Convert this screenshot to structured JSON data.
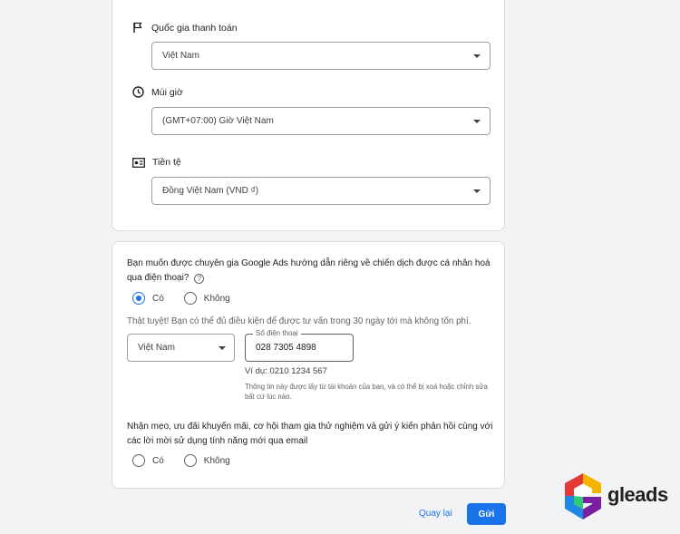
{
  "billing": {
    "country_label": "Quốc gia thanh toán",
    "country_value": "Việt Nam",
    "timezone_label": "Múi giờ",
    "timezone_value": "(GMT+07:00) Giờ Việt Nam",
    "currency_label": "Tiền tệ",
    "currency_value": "Đồng Việt Nam (VND ₫)"
  },
  "expert": {
    "question": "Bạn muốn được chuyên gia Google Ads hướng dẫn riêng về chiến dịch được cá nhân hoá qua điện thoại?",
    "help_glyph": "?",
    "options": [
      "Có",
      "Không"
    ],
    "selected": "Có",
    "eligible_text": "Thật tuyệt! Bạn có thể đủ điều kiện để được tư vấn trong 30 ngày tới mà không tốn phí.",
    "phone_country": "Việt Nam",
    "phone_label": "Số điện thoại",
    "phone_value": "028 7305 4898",
    "phone_example": "Ví dụ: 0210 1234 567",
    "phone_note": "Thông tin này được lấy từ tài khoản của bạn, và có thể bị xoá hoặc chỉnh sửa bất cứ lúc nào."
  },
  "email": {
    "question": "Nhận mẹo, ưu đãi khuyến mãi, cơ hội tham gia thử nghiệm và gửi ý kiến phản hồi cùng với các lời mời sử dụng tính năng mới qua email",
    "options": [
      "Có",
      "Không"
    ]
  },
  "actions": {
    "back_label": "Quay lại",
    "submit_label": "Gửi"
  },
  "logo": {
    "text": "gleads"
  },
  "colors": {
    "accent": "#1a73e8",
    "background": "#f1f3f4"
  }
}
